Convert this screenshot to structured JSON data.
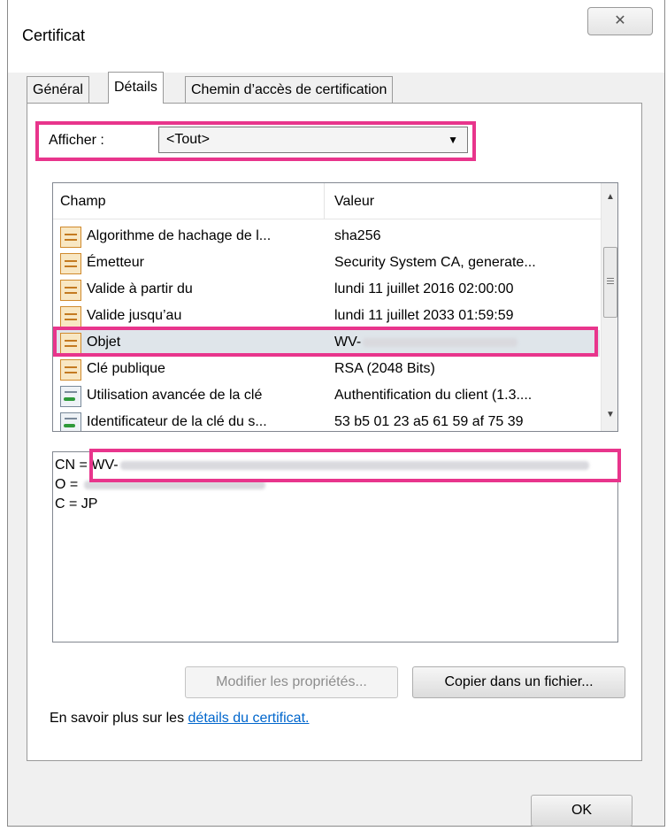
{
  "window": {
    "title": "Certificat",
    "close_glyph": "✕"
  },
  "tabs": [
    {
      "label": "Général"
    },
    {
      "label": "Détails"
    },
    {
      "label": "Chemin d’accès de certification"
    }
  ],
  "show": {
    "label": "Afficher :",
    "selected": "<Tout>"
  },
  "fields_table": {
    "headers": {
      "field": "Champ",
      "value": "Valeur"
    },
    "rows": [
      {
        "field": "Algorithme de hachage de l...",
        "value": "sha256",
        "icon": "certificate-field-icon"
      },
      {
        "field": "Émetteur",
        "value": "Security System CA, generate...",
        "icon": "certificate-field-icon"
      },
      {
        "field": "Valide à partir du",
        "value": "lundi 11 juillet 2016 02:00:00",
        "icon": "certificate-field-icon"
      },
      {
        "field": "Valide jusqu’au",
        "value": "lundi 11 juillet 2033 01:59:59",
        "icon": "certificate-field-icon"
      },
      {
        "field": "Objet",
        "value": "WV-",
        "icon": "certificate-field-icon",
        "selected": true
      },
      {
        "field": "Clé publique",
        "value": "RSA (2048 Bits)",
        "icon": "certificate-field-icon"
      },
      {
        "field": "Utilisation avancée de la clé",
        "value": "Authentification du client (1.3....",
        "icon": "certificate-extension-icon"
      },
      {
        "field": "Identificateur de la clé du s...",
        "value": "53 b5 01 23 a5 61 59 af 75 39",
        "icon": "certificate-extension-icon"
      }
    ]
  },
  "detail": {
    "lines": [
      {
        "prefix": "CN = ",
        "value": "WV-"
      },
      {
        "prefix": "O = ",
        "value": ""
      },
      {
        "prefix": "C = ",
        "value": "JP"
      }
    ]
  },
  "buttons": {
    "edit_properties": "Modifier les propriétés...",
    "copy_to_file": "Copier dans un fichier...",
    "ok": "OK"
  },
  "learn_more": {
    "text": "En savoir plus sur les",
    "link": "détails du certificat."
  },
  "colors": {
    "highlight": "#e8358c",
    "link": "#0066cc"
  }
}
